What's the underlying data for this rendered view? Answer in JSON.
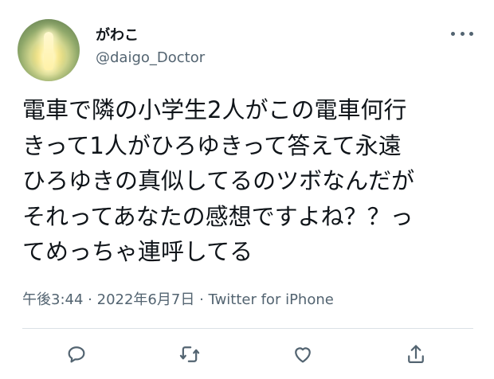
{
  "user": {
    "display_name": "がわこ",
    "handle": "@daigo_Doctor"
  },
  "tweet": {
    "text": "電車で隣の小学生2人がこの電車何行\nきって1人がひろゆきって答えて永遠\nひろゆきの真似してるのツボなんだが\nそれってあなたの感想ですよね？？っ\nてめっちゃ連呼してる"
  },
  "meta": {
    "time": "午後3:44",
    "separator": "·",
    "date": "2022年6月7日",
    "source": "Twitter for iPhone"
  },
  "icons": {
    "more": "more-horizontal-icon",
    "reply": "reply-icon",
    "retweet": "retweet-icon",
    "like": "heart-icon",
    "share": "share-icon"
  },
  "colors": {
    "text": "#0f1419",
    "secondary": "#536471",
    "divider": "#dbe1e6"
  }
}
